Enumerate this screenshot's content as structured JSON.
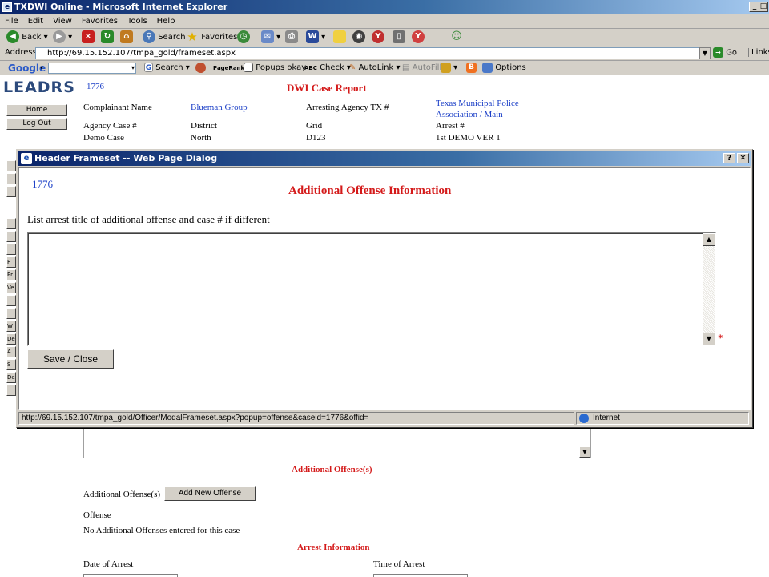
{
  "window": {
    "title": "TXDWI Online - Microsoft Internet Explorer",
    "menus": [
      "File",
      "Edit",
      "View",
      "Favorites",
      "Tools",
      "Help"
    ]
  },
  "toolbar": {
    "back": "Back",
    "search": "Search",
    "favorites": "Favorites"
  },
  "address": {
    "label": "Address",
    "url": "http://69.15.152.107/tmpa_gold/frameset.aspx",
    "go": "Go",
    "links": "Links"
  },
  "google_bar": {
    "logo": "Google",
    "search": "Search",
    "pagerank": "PageRank",
    "popups": "Popups okay",
    "check": "Check",
    "autolink": "AutoLink",
    "autofill": "AutoFill",
    "options": "Options"
  },
  "sidebar": {
    "logo": "LEADRS",
    "home": "Home",
    "logout": "Log Out",
    "stubs": [
      "F",
      "Pr",
      "Ve",
      "W",
      "De",
      "A",
      "S",
      "De"
    ]
  },
  "report": {
    "case_id": "1776",
    "title": "DWI Case Report",
    "complainant_label": "Complainant Name",
    "complainant_value": "Blueman Group",
    "arresting_agency_label": "Arresting Agency TX #",
    "arresting_agency_value": "Texas Municipal Police Association / Main",
    "agency_case_label": "Agency Case #",
    "district_label": "District",
    "grid_label": "Grid",
    "arrest_num_label": "Arrest #",
    "agency_case_value": "Demo Case",
    "district_value": "North",
    "grid_value": "D123",
    "arrest_num_value": "1st DEMO VER 1",
    "additional_offenses_heading": "Additional Offense(s)",
    "additional_offenses_label": "Additional Offense(s)",
    "add_new_offense": "Add New Offense",
    "offense_label": "Offense",
    "no_offenses": "No Additional Offenses entered for this case",
    "arrest_info_heading": "Arrest Information",
    "date_of_arrest": "Date of Arrest",
    "time_of_arrest": "Time of Arrest"
  },
  "dialog": {
    "title": "Header Frameset -- Web Page Dialog",
    "case_id": "1776",
    "heading": "Additional Offense Information",
    "instruction": "List arrest title of additional offense and case # if different",
    "textarea_value": "",
    "required_mark": "*",
    "save_close": "Save / Close",
    "status_url": "http://69.15.152.107/tmpa_gold/Officer/ModalFrameset.aspx?popup=offense&caseid=1776&offid=",
    "status_zone": "Internet"
  }
}
